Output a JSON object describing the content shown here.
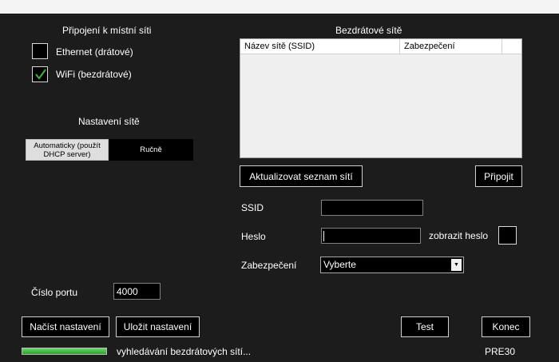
{
  "local_connection": {
    "title": "Připojení k místní síti",
    "ethernet": {
      "label": "Ethernet (drátové)",
      "checked": false
    },
    "wifi": {
      "label": "WiFi (bezdrátové)",
      "checked": true
    }
  },
  "network_settings": {
    "title": "Nastavení sítě",
    "mode_auto_label": "Automaticky (použít DHCP server)",
    "mode_manual_label": "Ručně",
    "selected_mode": "auto"
  },
  "wireless": {
    "title": "Bezdrátové sítě",
    "columns": [
      "Název sítě (SSID)",
      "Zabezpečení"
    ],
    "networks": [],
    "refresh_label": "Aktualizovat seznam sítí",
    "connect_label": "Připojit"
  },
  "form": {
    "ssid_label": "SSID",
    "ssid_value": "",
    "password_label": "Heslo",
    "password_value": "",
    "show_password_label": "zobrazit heslo",
    "show_password_checked": false,
    "security_label": "Zabezpečení",
    "security_value": "Vyberte"
  },
  "port": {
    "label": "Číslo portu",
    "value": "4000"
  },
  "buttons": {
    "load": "Načíst nastavení",
    "save": "Uložit nastavení",
    "test": "Test",
    "exit": "Konec"
  },
  "status": {
    "text": "vyhledávání bezdrátových sítí...",
    "progress_fraction": 1.0,
    "version": "PRE30"
  },
  "colors": {
    "background": "#1c1c1c",
    "check": "#3fb23f",
    "progress": "#28a428"
  }
}
